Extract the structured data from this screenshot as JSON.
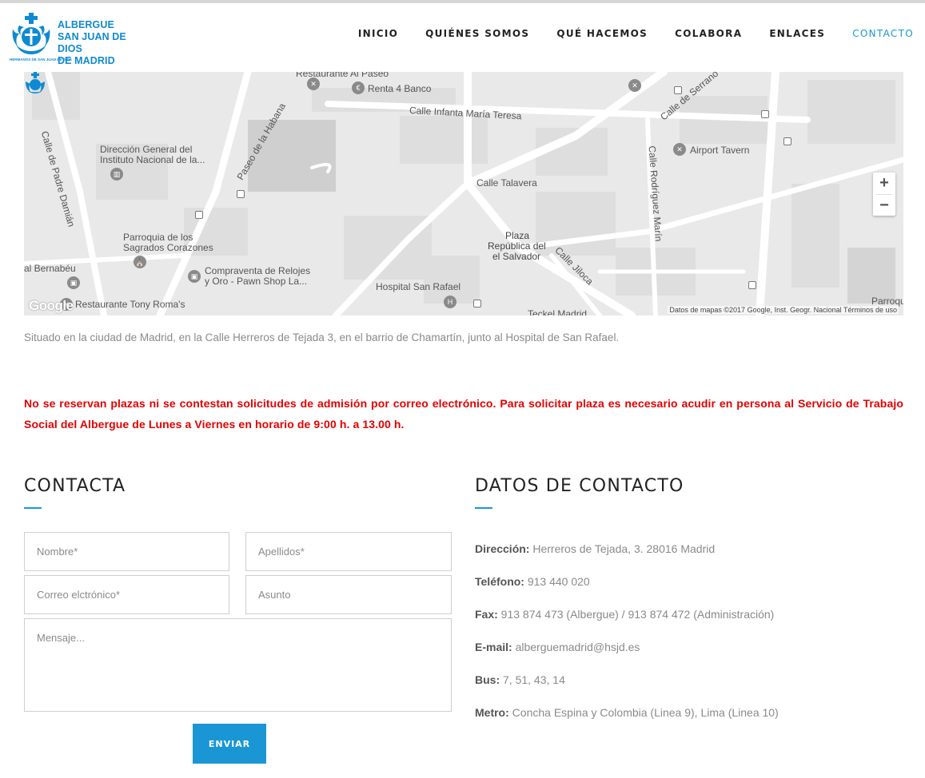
{
  "brand": {
    "line1": "ALBERGUE",
    "line2": "SAN JUAN DE DIOS",
    "line3": "DE MADRID",
    "small": "HERMANOS DE SAN JUAN DE DIOS",
    "color": "#0e8ad2"
  },
  "nav": {
    "items": [
      {
        "label": "INICIO"
      },
      {
        "label": "QUIÉNES SOMOS"
      },
      {
        "label": "QUÉ HACEMOS"
      },
      {
        "label": "COLABORA"
      },
      {
        "label": "ENLACES"
      },
      {
        "label": "CONTACTO",
        "active": true
      }
    ],
    "active_color": "#1a96d4"
  },
  "map": {
    "labels": {
      "restaurante_top": "Restaurante Al Paseo",
      "renta4": "Renta 4 Banco",
      "infanta": "Calle Infanta María Teresa",
      "serrano": "Calle de Serrano",
      "airport": "Airport Tavern",
      "direccion1": "Dirección General del",
      "direccion2": "Instituto Nacional de la...",
      "habana": "Paseo de la Habana",
      "talavera": "Calle Talavera",
      "rodriguez": "Calle Rodríguez Marín",
      "padre": "Calle de Padre Damián",
      "parroquia1": "Parroquia de los",
      "parroquia2": "Sagrados Corazones",
      "plaza1": "Plaza",
      "plaza2": "República del",
      "plaza3": "el Salvador",
      "jiloca": "Calle Jiloca",
      "bernabeu": "al Bernabéu",
      "compraventa1": "Compraventa de Relojes",
      "compraventa2": "y Oro - Pawn Shop La...",
      "hospital": "Hospital San Rafael",
      "tony": "Restaurante Tony Roma's",
      "teckel": "Teckel Madrid",
      "parroquia_n": "Parroquia N"
    },
    "google": "Google",
    "attribution": "Datos de mapas ©2017 Google, Inst. Geogr. Nacional    Términos de uso",
    "zoom_in": "+",
    "zoom_out": "−"
  },
  "location_text": "Situado en la ciudad de Madrid, en la Calle Herreros de Tejada 3, en el barrio de Chamartín, junto al Hospital de San Rafael.",
  "notice": "No se reservan plazas ni se contestan solicitudes de admisión por correo electrónico. Para solicitar plaza es necesario acudir en persona al Servicio de Trabajo Social del Albergue de Lunes a Viernes en horario de 9:00 h. a 13.00 h.",
  "notice_color": "#e30000",
  "form": {
    "title": "CONTACTA",
    "nombre_placeholder": "Nombre*",
    "apellidos_placeholder": "Apellidos*",
    "correo_placeholder": "Correo elctrónico*",
    "asunto_placeholder": "Asunto",
    "mensaje_placeholder": "Mensaje...",
    "submit_label": "ENVIAR"
  },
  "contact": {
    "title": "DATOS DE CONTACTO",
    "rows": [
      {
        "label": "Dirección:",
        "value": " Herreros de Tejada, 3. 28016 Madrid"
      },
      {
        "label": "Teléfono:",
        "value": " 913 440 020"
      },
      {
        "label": "Fax:",
        "value": " 913 874 473 (Albergue) / 913 874 472 (Administración)"
      },
      {
        "label": "E-mail:",
        "value": " alberguemadrid@hsjd.es"
      },
      {
        "label": "Bus:",
        "value": " 7, 51, 43, 14"
      },
      {
        "label": "Metro:",
        "value": " Concha Espina y Colombia (Linea 9), Lima (Linea 10)"
      }
    ]
  }
}
